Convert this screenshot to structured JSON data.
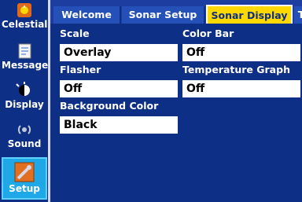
{
  "sidebar": {
    "items": [
      {
        "label": "Celestial",
        "icon": "celestial-icon"
      },
      {
        "label": "Message",
        "icon": "message-icon"
      },
      {
        "label": "Display",
        "icon": "display-icon"
      },
      {
        "label": "Sound",
        "icon": "sound-icon"
      },
      {
        "label": "Setup",
        "icon": "setup-icon",
        "active": true
      }
    ]
  },
  "tabs": [
    {
      "label": "Welcome"
    },
    {
      "label": "Sonar Setup"
    },
    {
      "label": "Sonar Display",
      "active": true
    },
    {
      "label": "T"
    }
  ],
  "fields": {
    "scale": {
      "label": "Scale",
      "value": "Overlay"
    },
    "color_bar": {
      "label": "Color Bar",
      "value": "Off"
    },
    "flasher": {
      "label": "Flasher",
      "value": "Off"
    },
    "temperature_graph": {
      "label": "Temperature Graph",
      "value": "Off"
    },
    "background_color": {
      "label": "Background Color",
      "value": "Black"
    }
  },
  "colors": {
    "background": "#0e2f86",
    "tab_active": "#ffd800",
    "sidebar_active": "#1ea8e8"
  }
}
